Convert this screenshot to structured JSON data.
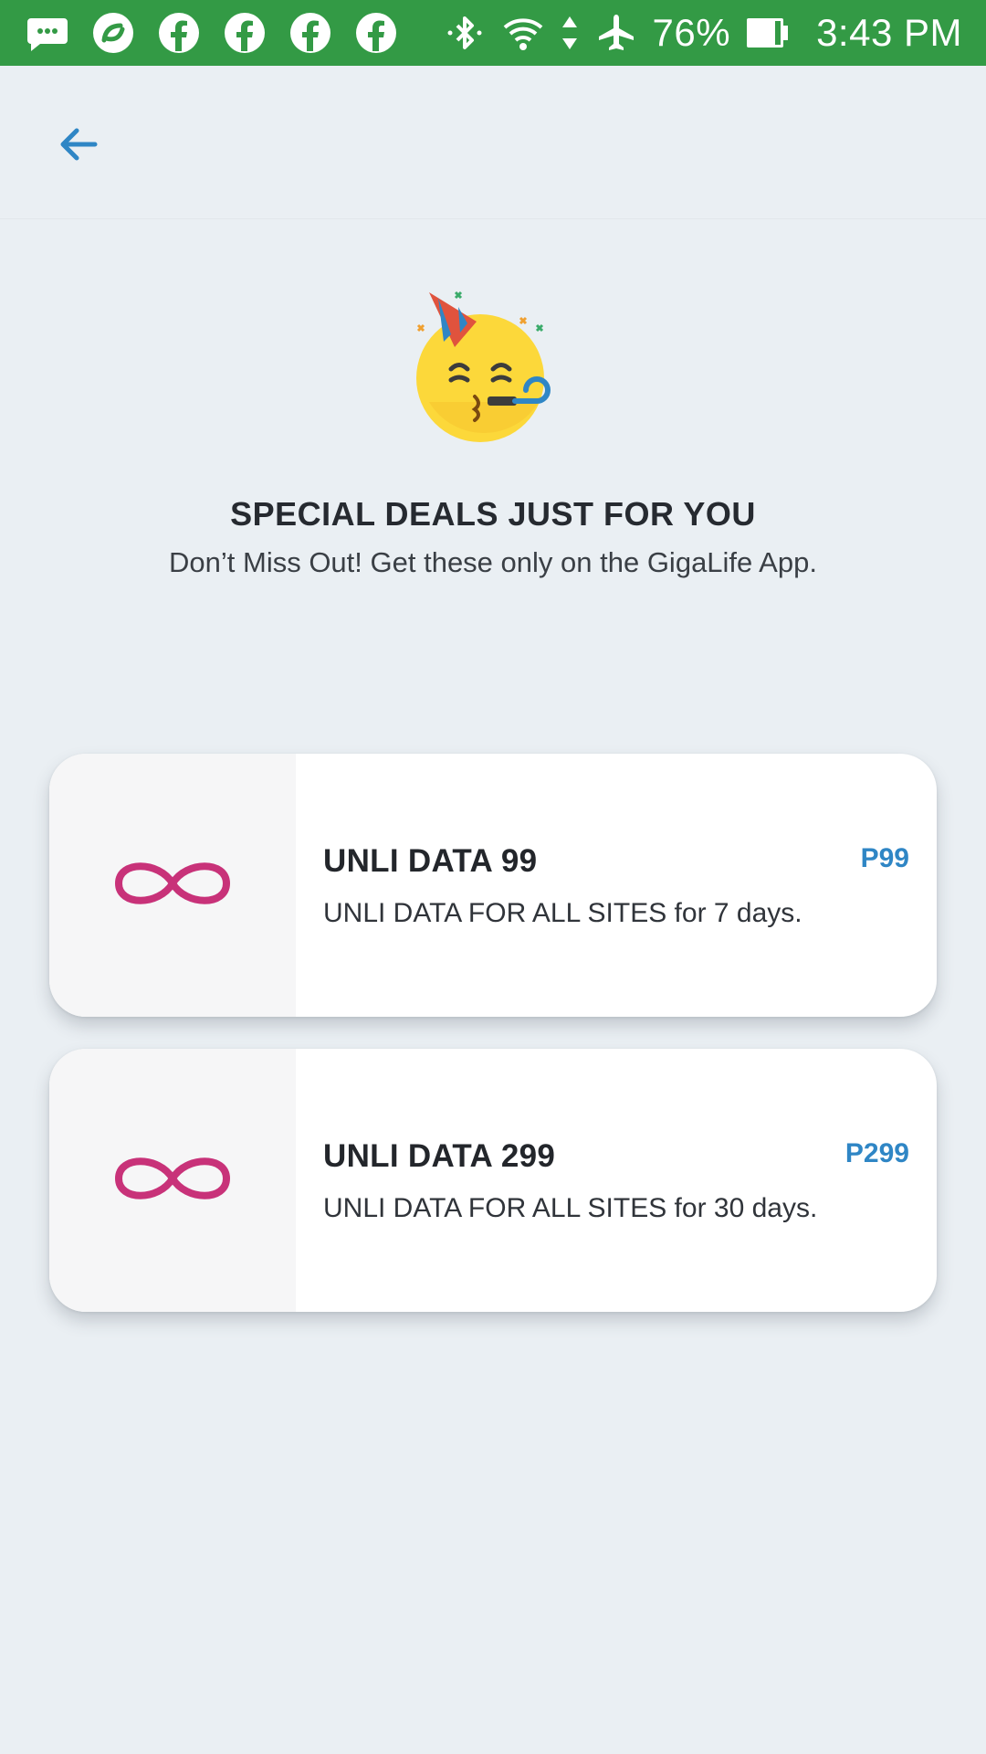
{
  "status_bar": {
    "battery": "76%",
    "time": "3:43 PM",
    "left_icons": [
      "messaging-icon",
      "sync-app-icon",
      "facebook-icon",
      "facebook-icon",
      "facebook-icon",
      "facebook-icon"
    ],
    "right_icons": [
      "bluetooth-icon",
      "wifi-icon",
      "data-arrows-icon",
      "airplane-icon",
      "battery-icon"
    ],
    "background": "#339a45"
  },
  "header": {
    "back_icon": "back-arrow-icon",
    "accent": "#2f86c5"
  },
  "hero": {
    "icon": "party-face-emoji",
    "title": "SPECIAL DEALS JUST FOR YOU",
    "subtitle": "Don’t Miss Out! Get these only on the GigaLife App."
  },
  "deals": [
    {
      "icon": "infinity-icon",
      "name": "UNLI DATA 99",
      "description": "UNLI DATA FOR ALL SITES for 7 days.",
      "price": "P99"
    },
    {
      "icon": "infinity-icon",
      "name": "UNLI DATA 299",
      "description": "UNLI DATA FOR ALL SITES for 30 days.",
      "price": "P299"
    }
  ],
  "colors": {
    "background": "#eaeff3",
    "infinity": "#c83279",
    "price": "#2f86c5"
  }
}
